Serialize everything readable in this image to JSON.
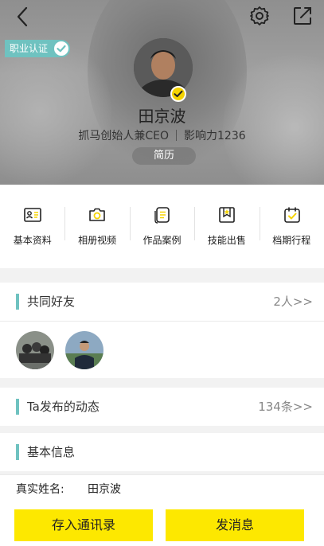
{
  "header": {
    "cert_label": "职业认证",
    "name": "田京波",
    "title": "抓马创始人兼CEO",
    "influence": "影响力1236",
    "resume_label": "简历"
  },
  "nav": {
    "items": [
      {
        "label": "基本资料",
        "icon": "id-card-icon"
      },
      {
        "label": "相册视频",
        "icon": "camera-icon"
      },
      {
        "label": "作品案例",
        "icon": "document-stack-icon"
      },
      {
        "label": "技能出售",
        "icon": "bookmark-star-icon"
      },
      {
        "label": "档期行程",
        "icon": "calendar-check-icon"
      }
    ]
  },
  "friends": {
    "title": "共同好友",
    "count": "2人>>"
  },
  "posts": {
    "title": "Ta发布的动态",
    "count": "134条>>"
  },
  "basic_info": {
    "title": "基本信息",
    "real_name_label": "真实姓名:",
    "real_name_value": "田京波"
  },
  "actions": {
    "save_contact": "存入通讯录",
    "send_message": "发消息"
  },
  "colors": {
    "accent": "#6fc2c0",
    "primary_button": "#fde800",
    "verified": "#f5d300"
  }
}
